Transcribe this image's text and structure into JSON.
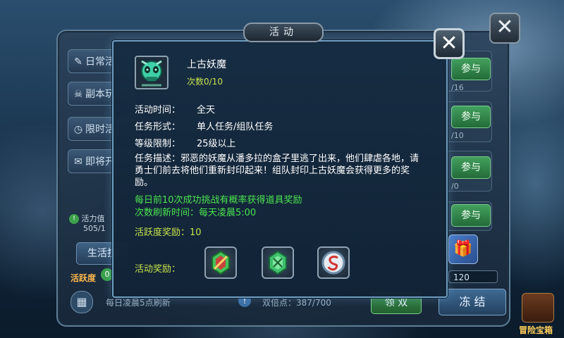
{
  "background": {
    "window_title": "活动",
    "close_icon": "close-icon",
    "side_tabs": [
      {
        "label": "日常活",
        "icon": "quill-icon"
      },
      {
        "label": "副本玩",
        "icon": "skull-icon"
      },
      {
        "label": "限时活",
        "icon": "clock-icon"
      },
      {
        "label": "即将开",
        "icon": "scroll-icon"
      }
    ],
    "join_label": "参与",
    "counts": [
      "/16",
      "/10",
      "/0"
    ],
    "vitality_label": "活力值",
    "vitality_value": "505/1",
    "life_button": "生活技",
    "activity_label": "活跃度",
    "activity_value": "0",
    "daily_reset": "每日凌晨5点刷新",
    "double_points": "双倍点：387/700",
    "claim_double": "领 双",
    "freeze": "冻 结",
    "right_value": "120",
    "adventure_label": "冒险宝箱"
  },
  "modal": {
    "close_icon": "close-icon",
    "boss_icon": "demon-skull-icon",
    "title": "上古妖魔",
    "count_label": "次数0/10",
    "rows": [
      {
        "label": "活动时间：",
        "value": "全天"
      },
      {
        "label": "任务形式：",
        "value": "单人任务/组队任务"
      },
      {
        "label": "等级限制：",
        "value": "25级以上"
      }
    ],
    "description": "任务描述：邪恶的妖魔从潘多拉的盒子里逃了出来，他们肆虐各地，请勇士们前去将他们重新封印起来！组队封印上古妖魔会获得更多的奖励。",
    "highlight_lines": [
      "每日前10次成功挑战有概率获得道具奖励",
      "次数刷新时间：每天凌晨5:00"
    ],
    "vitality_reward": "活跃度奖励：10",
    "rewards_label": "活动奖励：",
    "rewards": [
      {
        "icon": "red-green-gem-icon"
      },
      {
        "icon": "green-gem-icon"
      },
      {
        "icon": "silver-swirl-coin-icon"
      }
    ],
    "colors": {
      "border": "#6f9fc2",
      "highlight": "#4be34f",
      "accent": "#c8e24a"
    }
  }
}
